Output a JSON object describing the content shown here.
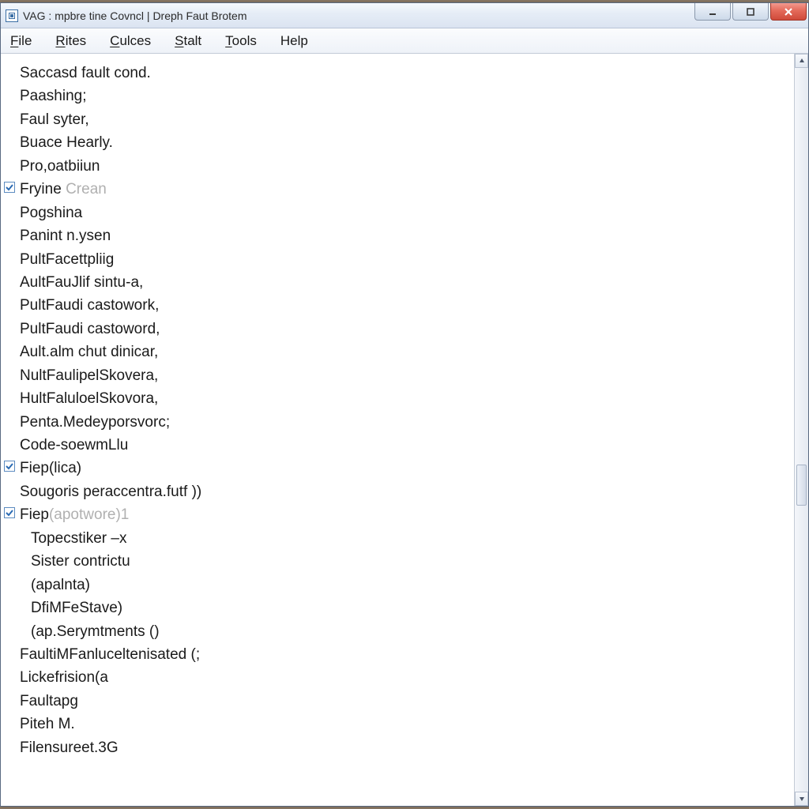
{
  "window": {
    "title": "VAG : mpbre tine Covncl | Dreph Faut Brotem"
  },
  "menu": {
    "items": [
      {
        "label": "File",
        "accel": "F"
      },
      {
        "label": "Rites",
        "accel": "R"
      },
      {
        "label": "Culces",
        "accel": "C"
      },
      {
        "label": "Stalt",
        "accel": "S"
      },
      {
        "label": "Tools",
        "accel": "T"
      },
      {
        "label": "Help",
        "accel": ""
      }
    ]
  },
  "content": {
    "lines": [
      {
        "text": "Saccasd fault cond.",
        "checked": false,
        "indent": 0
      },
      {
        "text": "Paashing;",
        "checked": false,
        "indent": 0
      },
      {
        "text": "Faul syter,",
        "checked": false,
        "indent": 0
      },
      {
        "text": "Buace Hearly.",
        "checked": false,
        "indent": 0
      },
      {
        "text": "Pro,oatbiiun",
        "checked": false,
        "indent": 0
      },
      {
        "text": "Fryine ",
        "suffix": "Crean",
        "checked": true,
        "indent": 0
      },
      {
        "text": "Pogshina",
        "checked": false,
        "indent": 0
      },
      {
        "text": "Panint n.ysen",
        "checked": false,
        "indent": 0
      },
      {
        "text": "PultFacettpliig",
        "checked": false,
        "indent": 0
      },
      {
        "text": "AultFauJlif sintu-a,",
        "checked": false,
        "indent": 0
      },
      {
        "text": "PultFaudi castowork,",
        "checked": false,
        "indent": 0
      },
      {
        "text": "PultFaudi castoword,",
        "checked": false,
        "indent": 0
      },
      {
        "text": "Ault.alm chut dinicar,",
        "checked": false,
        "indent": 0
      },
      {
        "text": "NultFaulipelSkovera,",
        "checked": false,
        "indent": 0
      },
      {
        "text": "HultFaluloelSkovora,",
        "checked": false,
        "indent": 0
      },
      {
        "text": "Penta.Medeyporsvorc;",
        "checked": false,
        "indent": 0
      },
      {
        "text": "Code-soewmLlu",
        "checked": false,
        "indent": 0
      },
      {
        "text": "Fiep(lica)",
        "checked": true,
        "indent": 0
      },
      {
        "text": "Sougoris peraccentra.futf ))",
        "checked": false,
        "indent": 0
      },
      {
        "text": "Fiep",
        "suffix": "(apotwore)1",
        "checked": true,
        "indent": 0
      },
      {
        "text": "Topecstiker –x",
        "checked": false,
        "indent": 1
      },
      {
        "text": "Sister contrictu",
        "checked": false,
        "indent": 1
      },
      {
        "text": "(apalnta)",
        "checked": false,
        "indent": 1
      },
      {
        "text": "DfiMFeStave)",
        "checked": false,
        "indent": 1
      },
      {
        "text": "(ap.Serymtments ()",
        "checked": false,
        "indent": 1
      },
      {
        "text": "FaultiMFanluceltenisated (;",
        "checked": false,
        "indent": 0
      },
      {
        "text": "Lickefrision(a",
        "checked": false,
        "indent": 0
      },
      {
        "text": "Faultapg",
        "checked": false,
        "indent": 0
      },
      {
        "text": "Piteh M.",
        "checked": false,
        "indent": 0
      },
      {
        "text": "Filensureet.3G",
        "checked": false,
        "indent": 0
      }
    ]
  },
  "icons": {
    "app": "app-icon",
    "minimize": "minimize-icon",
    "maximize": "maximize-icon",
    "close": "close-icon",
    "check": "check-icon",
    "scroll_up": "scroll-up-icon",
    "scroll_down": "scroll-down-icon"
  },
  "colors": {
    "titlebar_start": "#f6f9fd",
    "titlebar_end": "#dbe4f1",
    "close_start": "#f39a8f",
    "close_end": "#cf4a3a",
    "text": "#1a1a1a",
    "faded_text": "#b0b0b0",
    "check_border": "#5c8bc0"
  }
}
